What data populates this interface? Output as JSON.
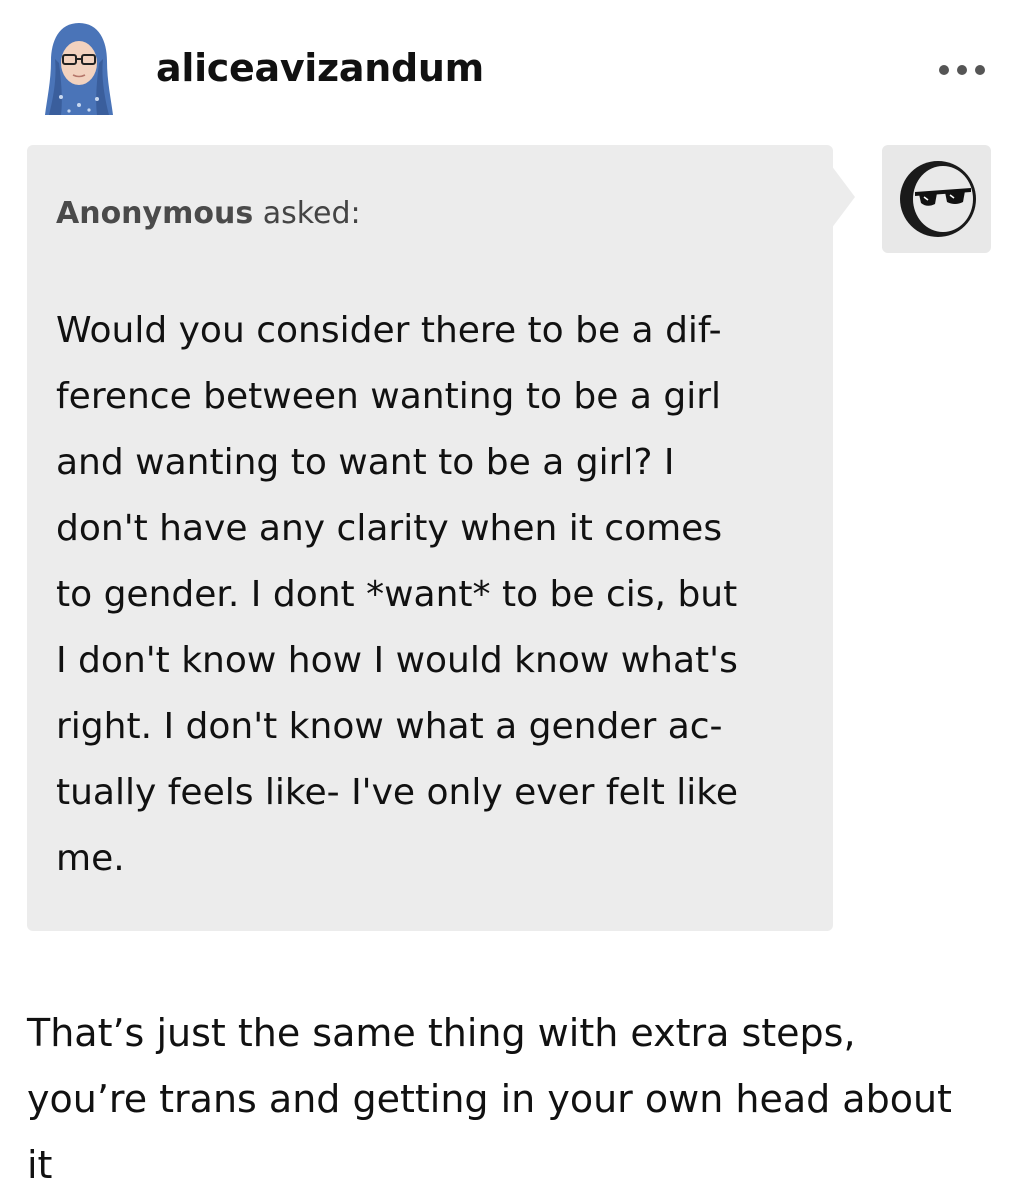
{
  "post": {
    "author": {
      "username": "aliceavizandum",
      "avatar_icon": "user-avatar-hijab-glasses"
    },
    "more_icon": "ellipsis-icon"
  },
  "ask": {
    "asker_name": "Anonymous",
    "asked_label": " asked:",
    "asker_avatar_icon": "sunglasses-avatar-icon",
    "question_lines": [
      "Would you consider there to be a dif-",
      "ference between wanting to be a girl",
      "and wanting to want to be a girl? I",
      "don't have any clarity when it comes",
      "to gender. I dont *want* to be cis, but",
      "I don't know how I would know what's",
      "right. I don't know what a gender ac-",
      "tually feels like- I've only ever felt like",
      "me."
    ]
  },
  "answer": {
    "lines": [
      "That’s just the same thing with extra steps,",
      "you’re trans and getting in your own head about",
      "it"
    ]
  },
  "colors": {
    "bubble_bg": "#ececec",
    "text": "#111111",
    "muted": "#444444"
  }
}
